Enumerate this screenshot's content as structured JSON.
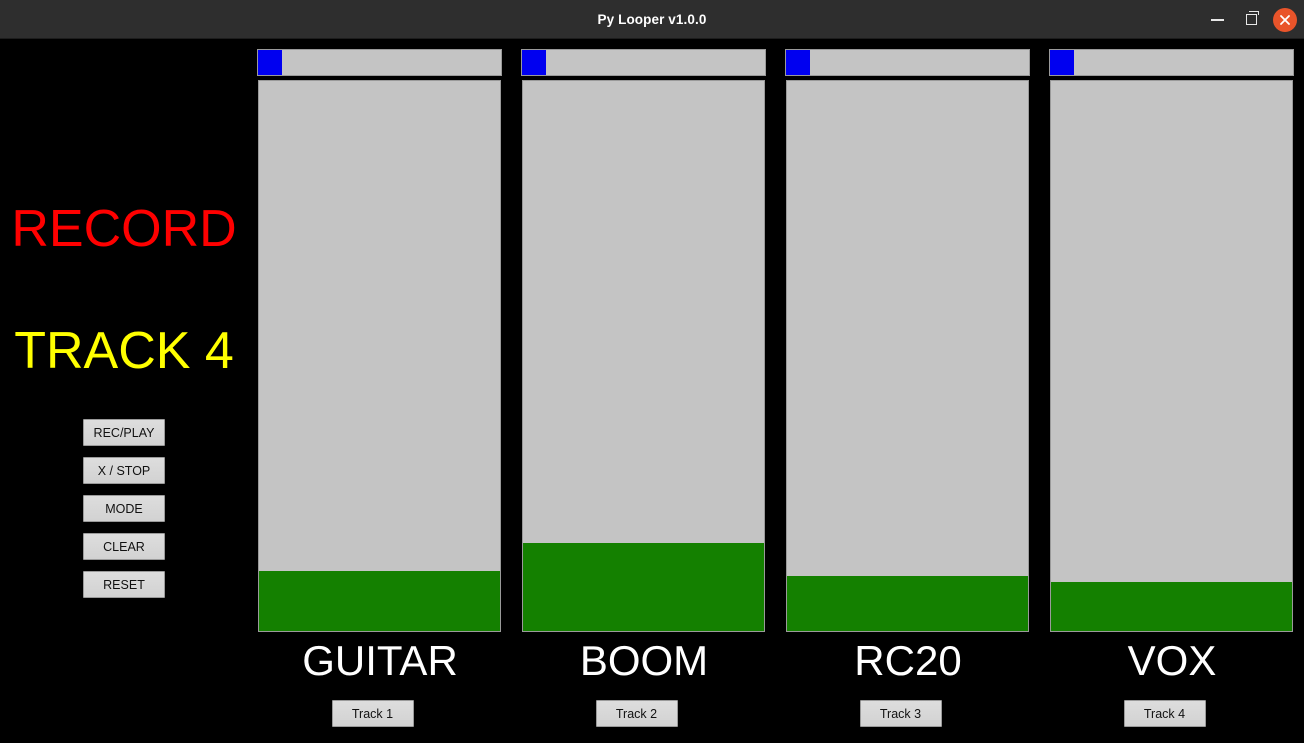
{
  "window": {
    "title": "Py Looper v1.0.0",
    "minimize_label": "_",
    "maximize_label": "□",
    "close_label": "×",
    "titlebar_color": "#2e2e2e",
    "close_button_color": "#e9542a"
  },
  "status": {
    "mode_label": "RECORD",
    "mode_color": "#ff0000",
    "track_label": "TRACK 4",
    "track_color": "#ffff00"
  },
  "controls": {
    "buttons": [
      {
        "label": "REC/PLAY"
      },
      {
        "label": "X / STOP"
      },
      {
        "label": "MODE"
      },
      {
        "label": "CLEAR"
      },
      {
        "label": "RESET"
      }
    ]
  },
  "colors": {
    "meter_background": "#c4c4c4",
    "meter_fill": "#148000",
    "slider_handle": "#0000f0",
    "panel_background": "#000000"
  },
  "tracks": [
    {
      "name": "GUITAR",
      "button_label": "Track 1",
      "slider_value": 0,
      "meter_fill_percent": 11
    },
    {
      "name": "BOOM",
      "button_label": "Track 2",
      "slider_value": 0,
      "meter_fill_percent": 16
    },
    {
      "name": "RC20",
      "button_label": "Track 3",
      "slider_value": 0,
      "meter_fill_percent": 10
    },
    {
      "name": "VOX",
      "button_label": "Track 4",
      "slider_value": 0,
      "meter_fill_percent": 9
    }
  ]
}
